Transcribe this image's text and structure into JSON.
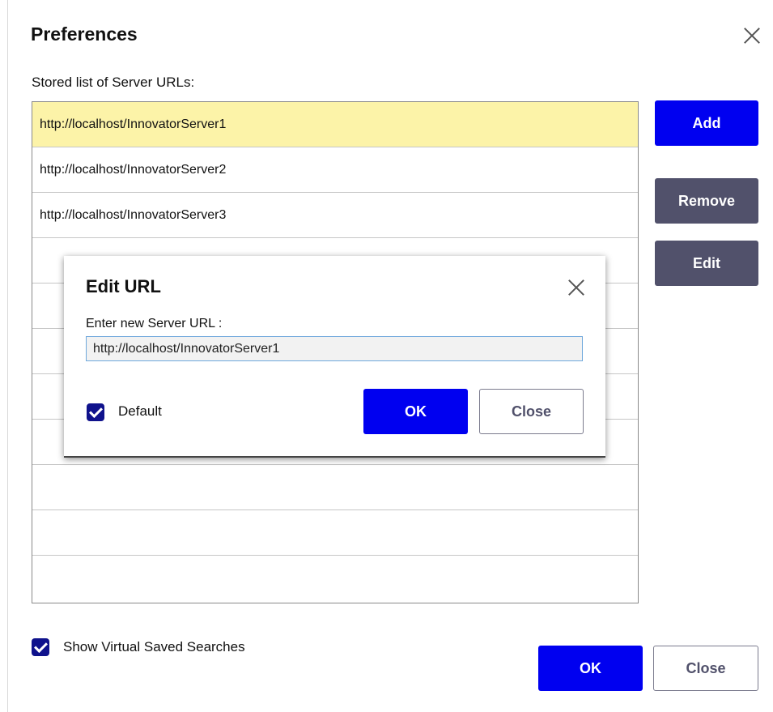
{
  "preferences": {
    "title": "Preferences",
    "list_label": "Stored list of Server URLs:",
    "urls": [
      "http://localhost/InnovatorServer1",
      "http://localhost/InnovatorServer2",
      "http://localhost/InnovatorServer3",
      "",
      "",
      "",
      "",
      "",
      "",
      "",
      ""
    ],
    "selected_index": 0,
    "buttons": {
      "add": "Add",
      "remove": "Remove",
      "edit": "Edit",
      "ok": "OK",
      "close": "Close"
    },
    "show_virtual_saved_searches": {
      "label": "Show Virtual Saved Searches",
      "checked": true
    }
  },
  "edit_url_dialog": {
    "title": "Edit URL",
    "field_label": "Enter new Server URL :",
    "field_value": "http://localhost/InnovatorServer1",
    "default_checkbox": {
      "label": "Default",
      "checked": true
    },
    "buttons": {
      "ok": "OK",
      "close": "Close"
    }
  },
  "colors": {
    "primary": "#0000f0",
    "secondary": "#51516b",
    "selected_row": "#fcf3a8",
    "checkbox": "#0f128c"
  }
}
